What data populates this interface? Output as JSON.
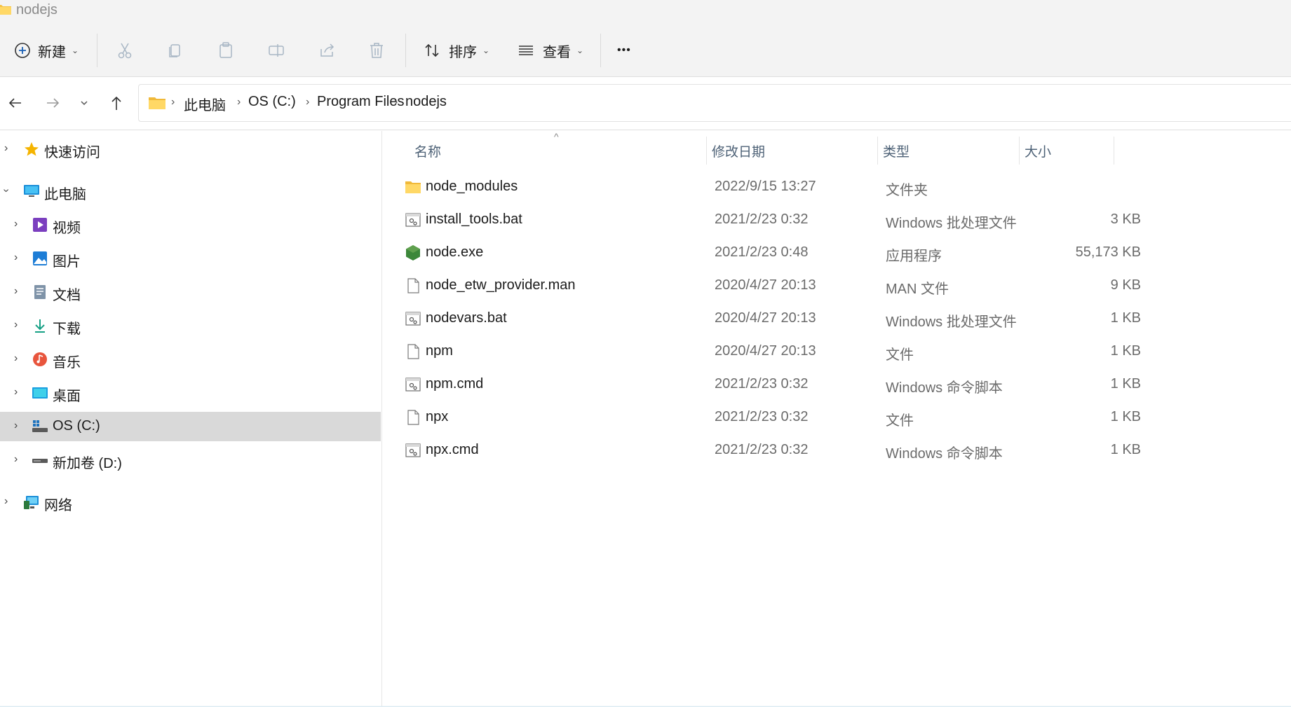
{
  "window": {
    "title": "nodejs"
  },
  "toolbar": {
    "new_label": "新建",
    "sort_label": "排序",
    "view_label": "查看",
    "more_label": "•••"
  },
  "address": {
    "crumbs": [
      "此电脑",
      "OS (C:)",
      "Program Files",
      "nodejs"
    ]
  },
  "sidebar": {
    "items": [
      {
        "label": "快速访问",
        "icon": "star-icon"
      },
      {
        "label": "此电脑",
        "icon": "computer-icon"
      },
      {
        "label": "视频",
        "icon": "video-icon"
      },
      {
        "label": "图片",
        "icon": "picture-icon"
      },
      {
        "label": "文档",
        "icon": "document-icon"
      },
      {
        "label": "下载",
        "icon": "download-icon"
      },
      {
        "label": "音乐",
        "icon": "music-icon"
      },
      {
        "label": "桌面",
        "icon": "desktop-icon"
      },
      {
        "label": "OS (C:)",
        "icon": "drive-c-icon"
      },
      {
        "label": "新加卷 (D:)",
        "icon": "drive-icon"
      },
      {
        "label": "网络",
        "icon": "network-icon"
      }
    ]
  },
  "columns": {
    "name": "名称",
    "date": "修改日期",
    "type": "类型",
    "size": "大小"
  },
  "files": [
    {
      "name": "node_modules",
      "date": "2022/9/15 13:27",
      "type": "文件夹",
      "size": "",
      "icon": "folder-icon"
    },
    {
      "name": "install_tools.bat",
      "date": "2021/2/23 0:32",
      "type": "Windows 批处理文件",
      "size": "3 KB",
      "icon": "batch-file-icon"
    },
    {
      "name": "node.exe",
      "date": "2021/2/23 0:48",
      "type": "应用程序",
      "size": "55,173 KB",
      "icon": "nodejs-icon"
    },
    {
      "name": "node_etw_provider.man",
      "date": "2020/4/27 20:13",
      "type": "MAN 文件",
      "size": "9 KB",
      "icon": "file-icon"
    },
    {
      "name": "nodevars.bat",
      "date": "2020/4/27 20:13",
      "type": "Windows 批处理文件",
      "size": "1 KB",
      "icon": "batch-file-icon"
    },
    {
      "name": "npm",
      "date": "2020/4/27 20:13",
      "type": "文件",
      "size": "1 KB",
      "icon": "file-icon"
    },
    {
      "name": "npm.cmd",
      "date": "2021/2/23 0:32",
      "type": "Windows 命令脚本",
      "size": "1 KB",
      "icon": "batch-file-icon"
    },
    {
      "name": "npx",
      "date": "2021/2/23 0:32",
      "type": "文件",
      "size": "1 KB",
      "icon": "file-icon"
    },
    {
      "name": "npx.cmd",
      "date": "2021/2/23 0:32",
      "type": "Windows 命令脚本",
      "size": "1 KB",
      "icon": "batch-file-icon"
    }
  ]
}
